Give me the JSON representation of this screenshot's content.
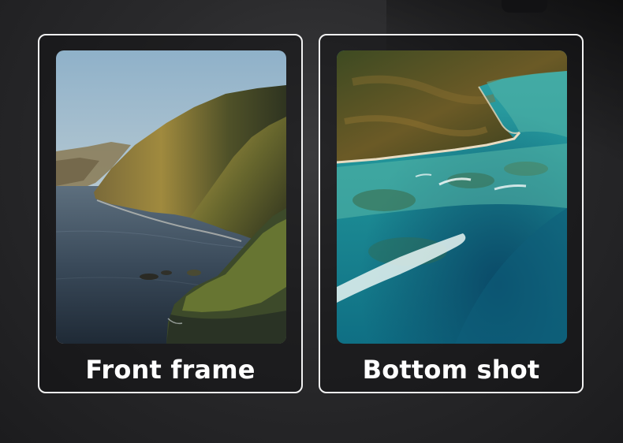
{
  "panels": [
    {
      "caption": "Front frame",
      "photo_subject": "coastal-cliffs-at-sunrise"
    },
    {
      "caption": "Bottom shot",
      "photo_subject": "aerial-reef-lagoon"
    }
  ],
  "colors": {
    "card_border": "#f2f2f2",
    "caption_text": "#ffffff",
    "background": "#2a2a2c"
  }
}
